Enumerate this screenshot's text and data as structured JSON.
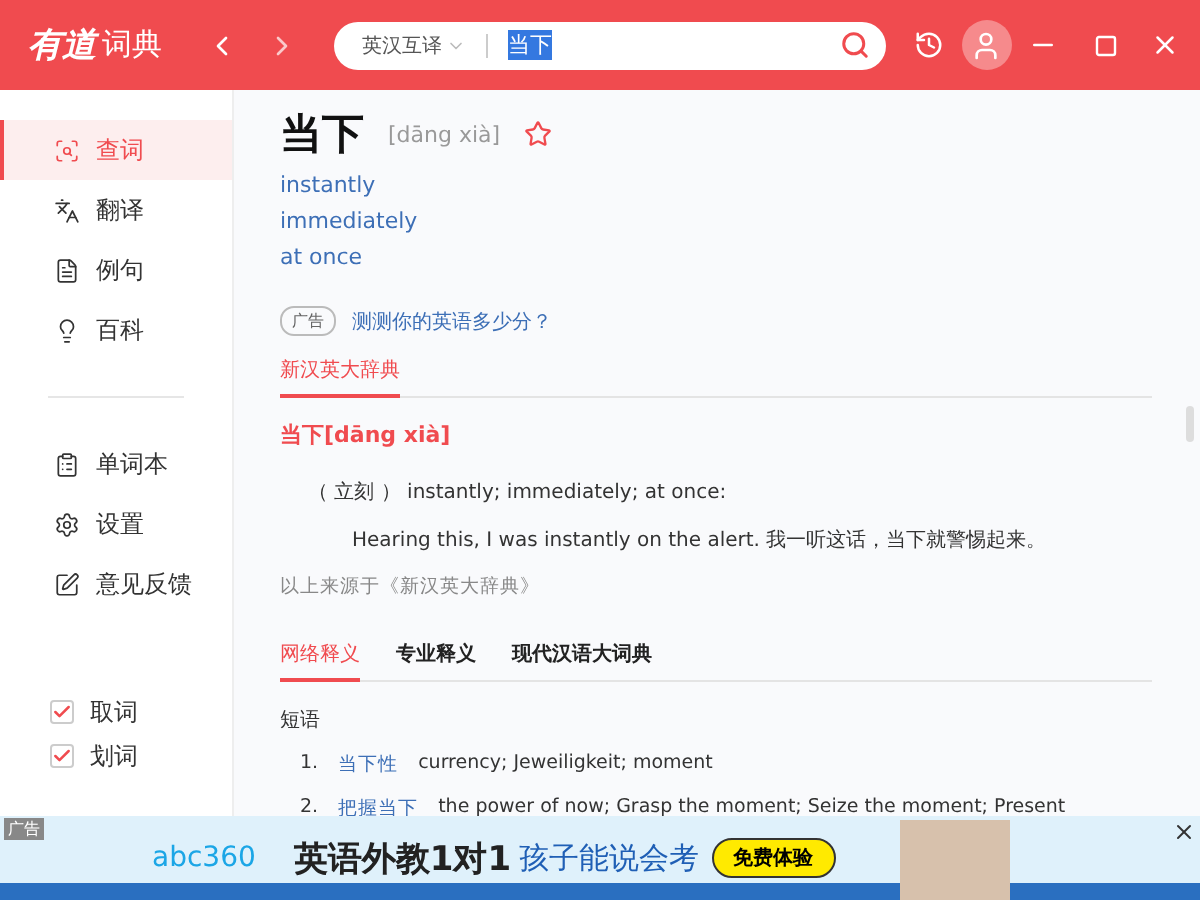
{
  "titlebar": {
    "logo_main": "有道",
    "logo_sub": "词典",
    "search": {
      "mode": "英汉互译",
      "value": "当下",
      "value_selected": true
    }
  },
  "sidebar": {
    "items": [
      {
        "label": "查词",
        "selected": true
      },
      {
        "label": "翻译",
        "selected": false
      },
      {
        "label": "例句",
        "selected": false
      },
      {
        "label": "百科",
        "selected": false
      }
    ],
    "tools": [
      {
        "label": "单词本"
      },
      {
        "label": "设置"
      },
      {
        "label": "意见反馈"
      }
    ],
    "toggles": [
      {
        "label": "取词",
        "checked": true
      },
      {
        "label": "划词",
        "checked": true
      }
    ]
  },
  "entry": {
    "word": "当下",
    "phonetic": "[dāng xià]",
    "starred": false,
    "meanings": [
      "instantly",
      "immediately",
      "at once"
    ],
    "promo": {
      "tag": "广告",
      "text": "测测你的英语多少分？"
    },
    "source_tabs": [
      {
        "label": "新汉英大辞典",
        "selected": true
      }
    ],
    "headword": "当下[dāng xià]",
    "definition": "（ 立刻 ） instantly; immediately; at once:",
    "example": "Hearing this, I was instantly on the alert. 我一听这话，当下就警惕起来。",
    "source_note": "以上来源于《新汉英大辞典》",
    "tabs": [
      {
        "label": "网络释义",
        "selected": true
      },
      {
        "label": "专业释义",
        "selected": false
      },
      {
        "label": "现代汉语大词典",
        "selected": false
      }
    ],
    "section": "短语",
    "phrases": [
      {
        "num": "1.",
        "term": "当下性",
        "gloss": "currency;   Jeweiligkeit;   moment"
      },
      {
        "num": "2.",
        "term": "把握当下",
        "gloss": "the power of now;   Grasp the moment;   Seize the moment;   Present"
      }
    ]
  },
  "banner": {
    "tag": "广告",
    "brand": "abc360",
    "slogan": "英语外教1对1",
    "tagline": "孩子能说会考",
    "cta": "免费体验"
  }
}
